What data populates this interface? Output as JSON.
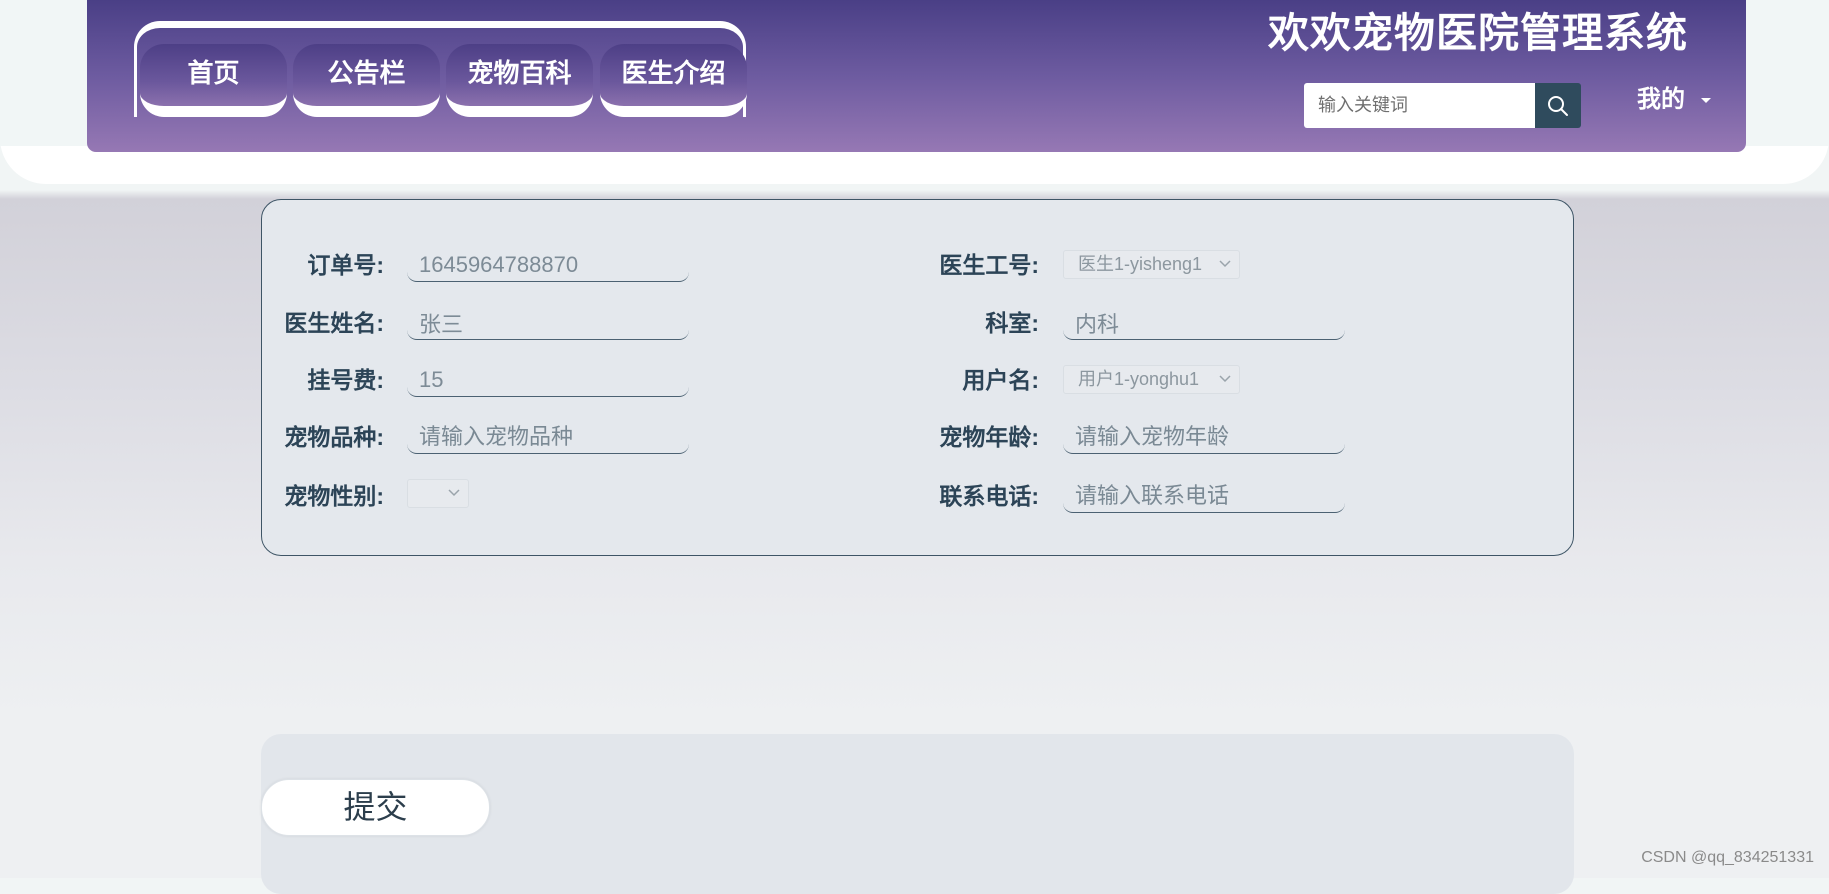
{
  "header": {
    "title": "欢欢宠物医院管理系统",
    "nav": [
      {
        "label": "首页"
      },
      {
        "label": "公告栏"
      },
      {
        "label": "宠物百科"
      },
      {
        "label": "医生介绍"
      }
    ],
    "search": {
      "placeholder": "输入关键词",
      "icon": "search-icon"
    },
    "user_menu": {
      "label": "我的",
      "icon": "caret-down-icon"
    }
  },
  "form": {
    "order_no": {
      "label": "订单号:",
      "value": "1645964788870"
    },
    "doctor_id": {
      "label": "医生工号:",
      "value": "医生1-yisheng1"
    },
    "doctor_name": {
      "label": "医生姓名:",
      "value": "张三"
    },
    "department": {
      "label": "科室:",
      "value": "内科"
    },
    "fee": {
      "label": "挂号费:",
      "value": "15"
    },
    "username": {
      "label": "用户名:",
      "value": "用户1-yonghu1"
    },
    "pet_breed": {
      "label": "宠物品种:",
      "placeholder": "请输入宠物品种"
    },
    "pet_age": {
      "label": "宠物年龄:",
      "placeholder": "请输入宠物年龄"
    },
    "pet_gender": {
      "label": "宠物性别:"
    },
    "phone": {
      "label": "联系电话:",
      "placeholder": "请输入联系电话"
    }
  },
  "actions": {
    "submit_label": "提交"
  },
  "watermark": "CSDN @qq_834251331",
  "colors": {
    "header_top": "#4a3f86",
    "header_bottom": "#9678b4",
    "label_text": "#2c4457",
    "search_button": "#2f4b5d",
    "card_border": "#3e5566",
    "card_background": "#e4e8ed"
  }
}
